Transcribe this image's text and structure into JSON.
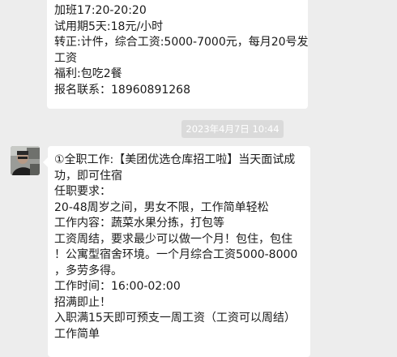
{
  "messages": [
    {
      "lines": [
        "加班17:20-20:20",
        "试用期5天:18元/小时",
        "转正:计件，综合工资:5000-7000元，每月20号发",
        "工资",
        "福利:包吃2餐",
        "报名联系：18960891268"
      ]
    },
    {
      "lines": [
        "①全职工作:【美团优选仓库招工啦】当天面试成",
        "功，即可住宿",
        "任职要求：",
        "20-48周岁之间，男女不限，工作简单轻松",
        "工作内容：蔬菜水果分拣，打包等",
        "工资周结，要求最少可以做一个月！包住，包住",
        "！公寓型宿舍环境。一个月综合工资5000-8000",
        "，多劳多得。",
        "工作时间：16:00-02:00",
        "招满即止！",
        "入职满15天即可预支一周工资（工资可以周结）",
        "工作简单"
      ]
    }
  ],
  "timestamp": "2023年4月7日 10:44"
}
